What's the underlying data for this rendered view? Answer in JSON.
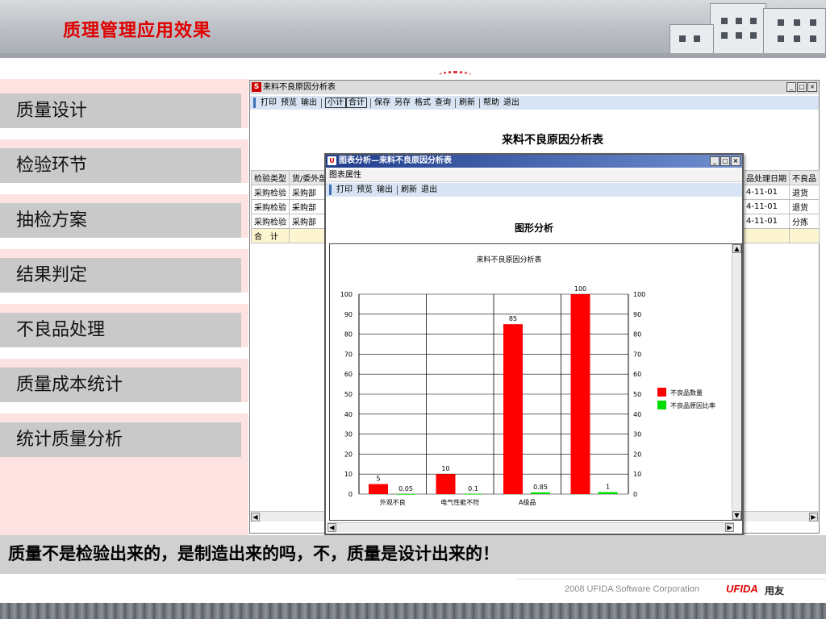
{
  "page_title": "质理管理应用效果",
  "menu": {
    "items": [
      {
        "label": "质量设计"
      },
      {
        "label": "检验环节"
      },
      {
        "label": "抽检方案"
      },
      {
        "label": "结果判定"
      },
      {
        "label": "不良品处理"
      },
      {
        "label": "质量成本统计"
      },
      {
        "label": "统计质量分析"
      }
    ]
  },
  "app": {
    "title": "来料不良原因分析表",
    "logo": "S",
    "toolbar": {
      "print": "打印",
      "preview": "预览",
      "output": "输出",
      "subtotal": "小计",
      "total": "合计",
      "save": "保存",
      "save_as": "另存",
      "format": "格式",
      "query": "查询",
      "refresh": "刷新",
      "help": "帮助",
      "exit": "退出"
    },
    "report_title": "来料不良原因分析表",
    "table_left": {
      "headers": [
        "检验类型",
        "货/委外部"
      ],
      "rows": [
        [
          "采购检验",
          "采购部"
        ],
        [
          "采购检验",
          "采购部"
        ],
        [
          "采购检验",
          "采购部"
        ]
      ],
      "total_label": "合　计"
    },
    "table_right": {
      "headers": [
        "品处理日期",
        "不良品"
      ],
      "rows": [
        [
          "4-11-01",
          "退货"
        ],
        [
          "4-11-01",
          "退货"
        ],
        [
          "4-11-01",
          "分拣"
        ]
      ]
    },
    "window_buttons": {
      "min": "_",
      "max": "□",
      "close": "×"
    }
  },
  "dialog": {
    "title": "图表分析—来料不良原因分析表",
    "menu_label": "图表属性",
    "toolbar": {
      "print": "打印",
      "preview": "预览",
      "output": "输出",
      "refresh": "刷新",
      "exit": "退出"
    },
    "heading": "图形分析"
  },
  "chart_data": {
    "type": "bar",
    "title": "来料不良原因分析表",
    "categories": [
      "外观不良",
      "电气性能不符",
      "A级品",
      ""
    ],
    "series": [
      {
        "name": "不良品数量",
        "color": "#ff0000",
        "values": [
          5,
          10,
          85,
          100
        ],
        "labels": [
          "5",
          "10",
          "85",
          "100"
        ]
      },
      {
        "name": "不良品原因比率",
        "color": "#00dd00",
        "values": [
          0.05,
          0.1,
          0.85,
          1
        ],
        "labels": [
          "0.05",
          "0.1",
          "0.85",
          "1"
        ]
      }
    ],
    "ylim": [
      0,
      100
    ],
    "yticks": [
      0,
      10,
      20,
      30,
      40,
      50,
      60,
      70,
      80,
      90,
      100
    ],
    "grid": true,
    "legend": "right"
  },
  "caption": "质量不是检验出来的，是制造出来的吗，不，质量是设计出来的！",
  "footer": {
    "copyright": "2008 UFIDA Software Corporation",
    "brand": "UFIDA",
    "brand_cn": "用友"
  }
}
